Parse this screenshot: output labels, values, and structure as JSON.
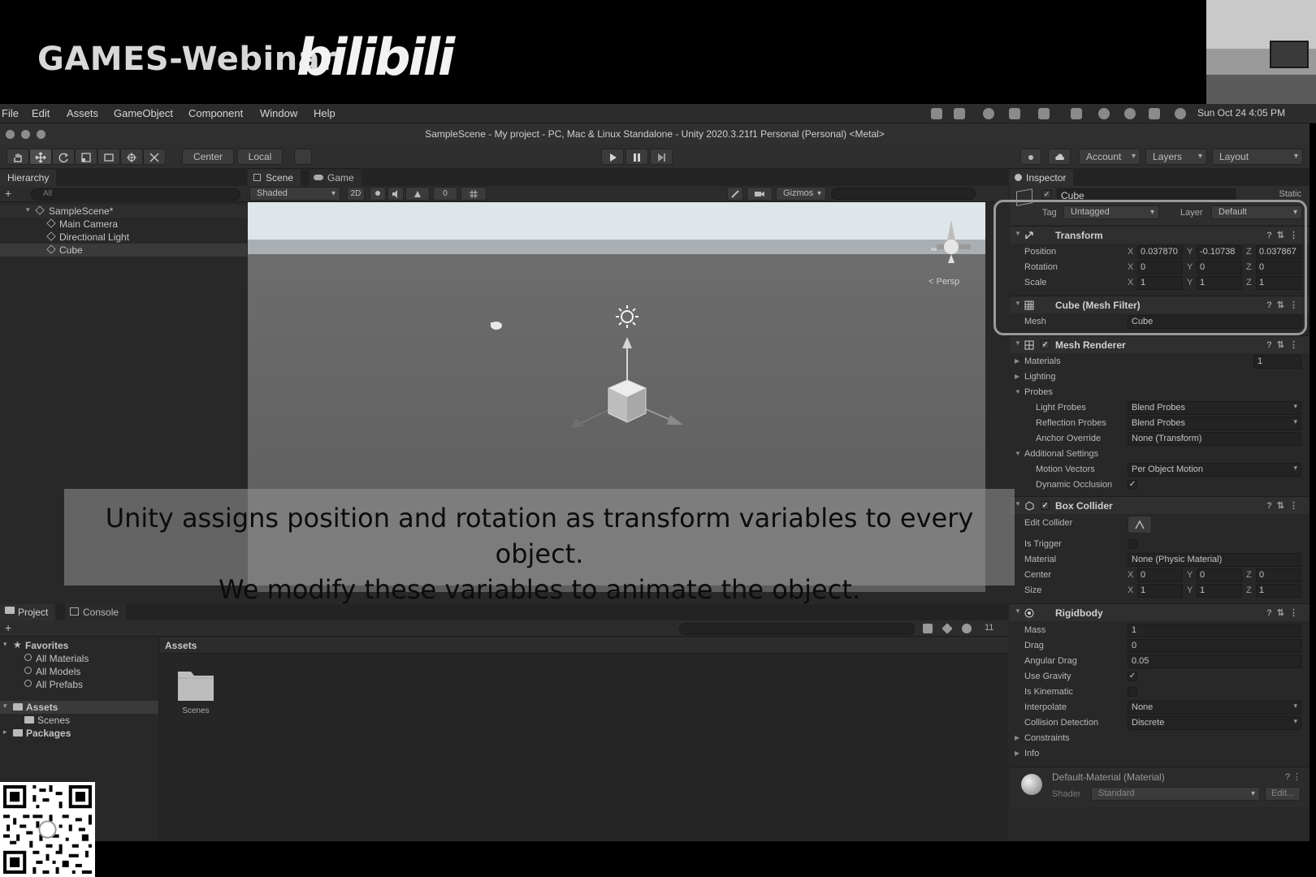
{
  "banner": {
    "title": "GAMES-Webinar",
    "logo": "bilibili"
  },
  "menubar": {
    "items": [
      "File",
      "Edit",
      "Assets",
      "GameObject",
      "Component",
      "Window",
      "Help"
    ],
    "clock": "Sun Oct 24  4:05 PM"
  },
  "window": {
    "title": "SampleScene - My project - PC, Mac & Linux Standalone - Unity 2020.3.21f1 Personal (Personal) <Metal>"
  },
  "toolbar": {
    "pivot": "Center",
    "space": "Local",
    "account": "Account",
    "layers": "Layers",
    "layout": "Layout"
  },
  "hierarchy": {
    "tab": "Hierarchy",
    "search_placeholder": "All",
    "scene": "SampleScene*",
    "items": [
      "Main Camera",
      "Directional Light",
      "Cube"
    ]
  },
  "scene_view": {
    "tabs": [
      "Scene",
      "Game"
    ],
    "shading": "Shaded",
    "mode_2d": "2D",
    "gizmos": "Gizmos",
    "hidden_count": "0",
    "persp_label": "< Persp"
  },
  "caption": {
    "line1": "Unity assigns position and rotation as transform variables to every object.",
    "line2": "We modify these variables to animate the object."
  },
  "project": {
    "tabs": [
      "Project",
      "Console"
    ],
    "favorites_label": "Favorites",
    "favorites": [
      "All Materials",
      "All Models",
      "All Prefabs"
    ],
    "assets_label": "Assets",
    "asset_children": [
      "Scenes"
    ],
    "packages_label": "Packages",
    "breadcrumb": "Assets",
    "grid_items": [
      "Scenes"
    ],
    "hidden_count": "11"
  },
  "inspector": {
    "tab": "Inspector",
    "object_name": "Cube",
    "static_label": "Static",
    "tag_label": "Tag",
    "tag_value": "Untagged",
    "layer_label": "Layer",
    "layer_value": "Default",
    "transform": {
      "title": "Transform",
      "position_label": "Position",
      "position": {
        "x": "0.037870",
        "y": "-0.10738",
        "z": "0.037867"
      },
      "rotation_label": "Rotation",
      "rotation": {
        "x": "0",
        "y": "0",
        "z": "0"
      },
      "scale_label": "Scale",
      "scale": {
        "x": "1",
        "y": "1",
        "z": "1"
      }
    },
    "mesh_filter": {
      "title": "Cube (Mesh Filter)",
      "mesh_label": "Mesh",
      "mesh_value": "Cube"
    },
    "mesh_renderer": {
      "title": "Mesh Renderer",
      "materials_label": "Materials",
      "materials_count": "1",
      "lighting_label": "Lighting",
      "probes_label": "Probes",
      "light_probes_label": "Light Probes",
      "light_probes_value": "Blend Probes",
      "reflection_probes_label": "Reflection Probes",
      "reflection_probes_value": "Blend Probes",
      "anchor_override_label": "Anchor Override",
      "anchor_override_value": "None (Transform)",
      "additional_label": "Additional Settings",
      "motion_vectors_label": "Motion Vectors",
      "motion_vectors_value": "Per Object Motion",
      "dynamic_occlusion_label": "Dynamic Occlusion"
    },
    "box_collider": {
      "title": "Box Collider",
      "edit_collider_label": "Edit Collider",
      "is_trigger_label": "Is Trigger",
      "material_label": "Material",
      "material_value": "None (Physic Material)",
      "center_label": "Center",
      "center": {
        "x": "0",
        "y": "0",
        "z": "0"
      },
      "size_label": "Size",
      "size": {
        "x": "1",
        "y": "1",
        "z": "1"
      }
    },
    "rigidbody": {
      "title": "Rigidbody",
      "mass_label": "Mass",
      "mass": "1",
      "drag_label": "Drag",
      "drag": "0",
      "angular_drag_label": "Angular Drag",
      "angular_drag": "0.05",
      "use_gravity_label": "Use Gravity",
      "is_kinematic_label": "Is Kinematic",
      "interpolate_label": "Interpolate",
      "interpolate": "None",
      "collision_detection_label": "Collision Detection",
      "collision_detection": "Discrete",
      "constraints_label": "Constraints",
      "info_label": "Info"
    },
    "material": {
      "title": "Default-Material (Material)",
      "shader_label": "Shader",
      "shader_value": "Standard",
      "edit_label": "Edit..."
    }
  },
  "colors": {
    "highlight_outline": "#9a9a9a",
    "sky": "#dfe6ea",
    "ground": "#666666"
  }
}
